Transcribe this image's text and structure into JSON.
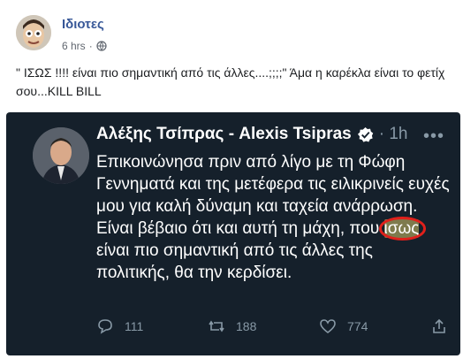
{
  "post": {
    "author": "Ιδιοτες",
    "time": "6 hrs",
    "dot": "·",
    "text": "\" ΙΣΩΣ !!!! είναι πιο σημαντική από τις άλλες....;;;;\" Άμα η καρέκλα είναι το φετίχ σου...KILL BILL"
  },
  "tweet": {
    "name": "Αλέξης Τσίπρας - Alexis Tsipras",
    "time": "1h",
    "more": "•••",
    "body_before": "Επικοινώνησα πριν από λίγο με τη Φώφη Γεννηματά και της μετέφερα τις ειλικρινείς ευχές μου για καλή δύναμη και ταχεία ανάρρωση. Είναι βέβαιο ότι και αυτή τη μάχη, που ",
    "body_highlight": "ίσως",
    "body_after": " είναι πιο σημαντική από τις άλλες της πολιτικής, θα την κερδίσει.",
    "replies": "111",
    "retweets": "188",
    "likes": "774",
    "colors": {
      "background": "#15202b",
      "muted": "#8899a6",
      "verified": "#ffffff",
      "circle": "#e0201b"
    }
  }
}
